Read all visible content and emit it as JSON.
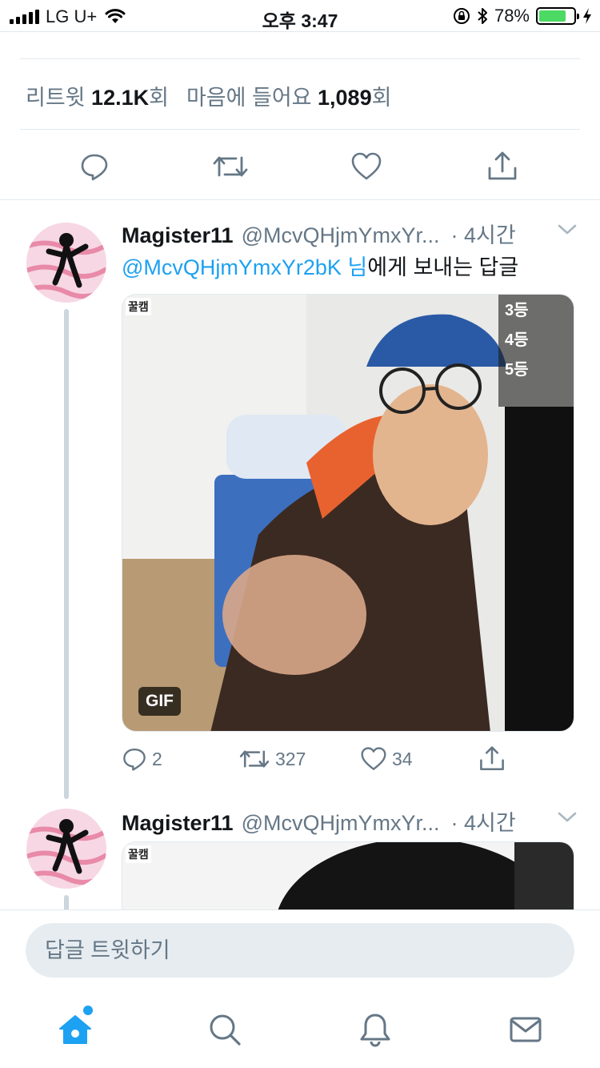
{
  "status_bar": {
    "carrier": "LG U+",
    "time": "오후 3:47",
    "battery": "78%",
    "battery_level": 0.78,
    "battery_color": "#4cd964"
  },
  "tweet_stats": {
    "retweet_label": "리트윗",
    "retweet_count": "12.1K",
    "retweet_suffix": "회",
    "like_label": "마음에 들어요",
    "like_count": "1,089",
    "like_suffix": "회"
  },
  "action_icons": [
    "reply-icon",
    "retweet-icon",
    "like-icon",
    "share-icon"
  ],
  "reply_tweets": [
    {
      "name": "Magister11",
      "handle": "@McvQHjmYmxYr...",
      "time": "· 4시간",
      "reply_to_mention": "@McvQHjmYmxYr2bK 님",
      "reply_to_suffix": "에게 보내는 답글",
      "media_tag": "꿀캠",
      "media_badge": "GIF",
      "overlay_ranks": [
        "3등",
        "4등",
        "5등"
      ],
      "replies": "2",
      "retweets": "327",
      "likes": "34"
    },
    {
      "name": "Magister11",
      "handle": "@McvQHjmYmxYr...",
      "time": "· 4시간",
      "media_tag": "꿀캠"
    }
  ],
  "composer": {
    "placeholder": "답글 트윗하기"
  },
  "tab_bar": {
    "tabs": [
      "home-icon",
      "search-icon",
      "notifications-icon",
      "messages-icon"
    ],
    "active": "home-icon",
    "accent": "#1da1f2"
  },
  "colors": {
    "link": "#1da1f2",
    "secondary_text": "#657786",
    "divider": "#e1e8ed"
  }
}
